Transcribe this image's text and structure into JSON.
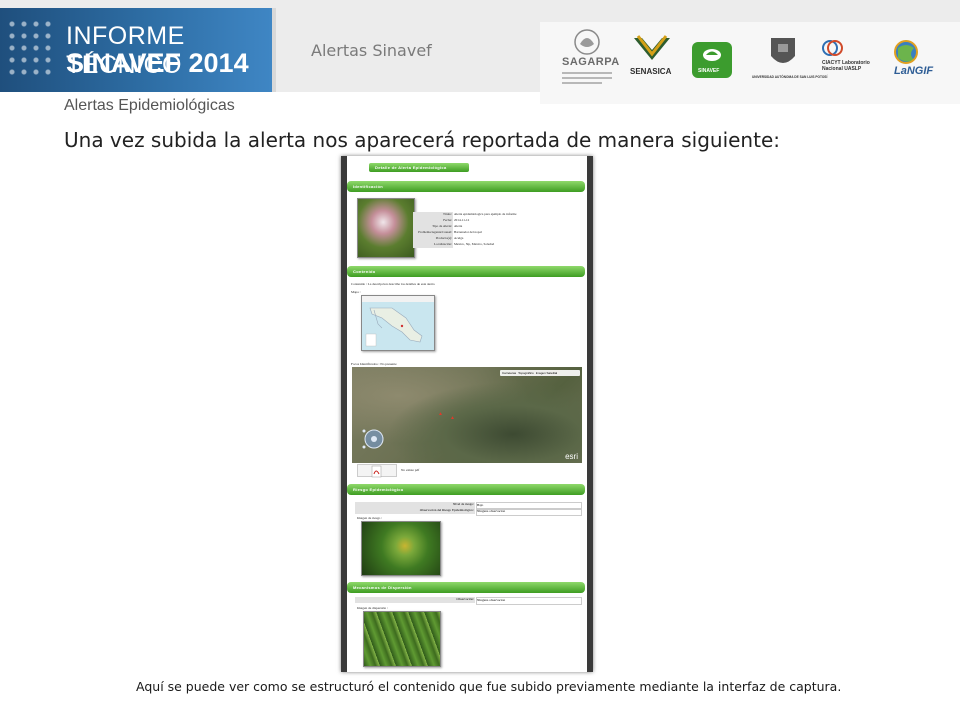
{
  "header": {
    "brand_line1": "INFORME TÉCNICO",
    "brand_line2": "SINAVEF 2014",
    "subtitle": "Alertas Sinavef",
    "logos": [
      {
        "name": "SAGARPA",
        "caption": "SAGARPA"
      },
      {
        "name": "SENASICA",
        "caption": "SENASICA"
      },
      {
        "name": "SINAVEF",
        "caption": "SINAVEF"
      },
      {
        "name": "Universidad Autónoma de San Luis Potosí",
        "caption": "UNIVERSIDAD AUTÓNOMA DE SAN LUIS POTOSÍ"
      },
      {
        "name": "CIACYT",
        "caption": "CIACYT Laboratorio Nacional UASLP"
      },
      {
        "name": "LaNGIF",
        "caption": "LaNGIF"
      }
    ]
  },
  "section_label": "Alertas Epidemiológicas",
  "main_heading": "Una vez subida la alerta nos aparecerá reportada de manera siguiente:",
  "screenshot": {
    "page_title": "Detalle de Alerta Epidemiológica",
    "sections": {
      "identification": "Identificación",
      "content": "Contenido",
      "risk": "Riesgo Epidemiológico",
      "dispersion": "Mecanismos de Dispersión"
    },
    "fields": [
      {
        "key": "Título:",
        "value": "Alerta epidemiologica para ejemplo de informe"
      },
      {
        "key": "Fecha:",
        "value": "2014-11-12"
      },
      {
        "key": "Tipo de Alerta:",
        "value": "Alerta"
      },
      {
        "key": "Problema/Agente/Causal:",
        "value": "Barrenador del nopal"
      },
      {
        "key": "Producto(s):",
        "value": "Acelga"
      },
      {
        "key": "Localización:",
        "value": "Mexico, Slp, Mexico, Soledad"
      }
    ],
    "content_text": "Contenido : La descripcion describe los detalles de esta alerta",
    "map_label": "Mapa :",
    "focos_label": "Focos Identificados : No presente",
    "map_buttons": [
      "Carreteras",
      "Topográfico",
      "Imagen Satelital"
    ],
    "esri_label": "esri",
    "pdf_label": "No existe pdf",
    "risk_fields": [
      {
        "key": "Nivel de riesgo:",
        "value": "Bajo"
      },
      {
        "key": "Observación del Riesgo Epidemiológico:",
        "value": "Ninguna observacion"
      }
    ],
    "risk_image_label": "Imagen de riesgo :",
    "dispersion_fields": [
      {
        "key": "Observación:",
        "value": "Ninguna observacion"
      }
    ],
    "dispersion_image_label": "Imagen de dispersión :"
  },
  "footer_caption": "Aquí se puede ver como se estructuró el contenido que fue subido previamente mediante la interfaz de captura.",
  "colors": {
    "brand_blue": "#2e6ea5",
    "section_green": "#3e9d22",
    "text_gray": "#7a7a7a"
  }
}
